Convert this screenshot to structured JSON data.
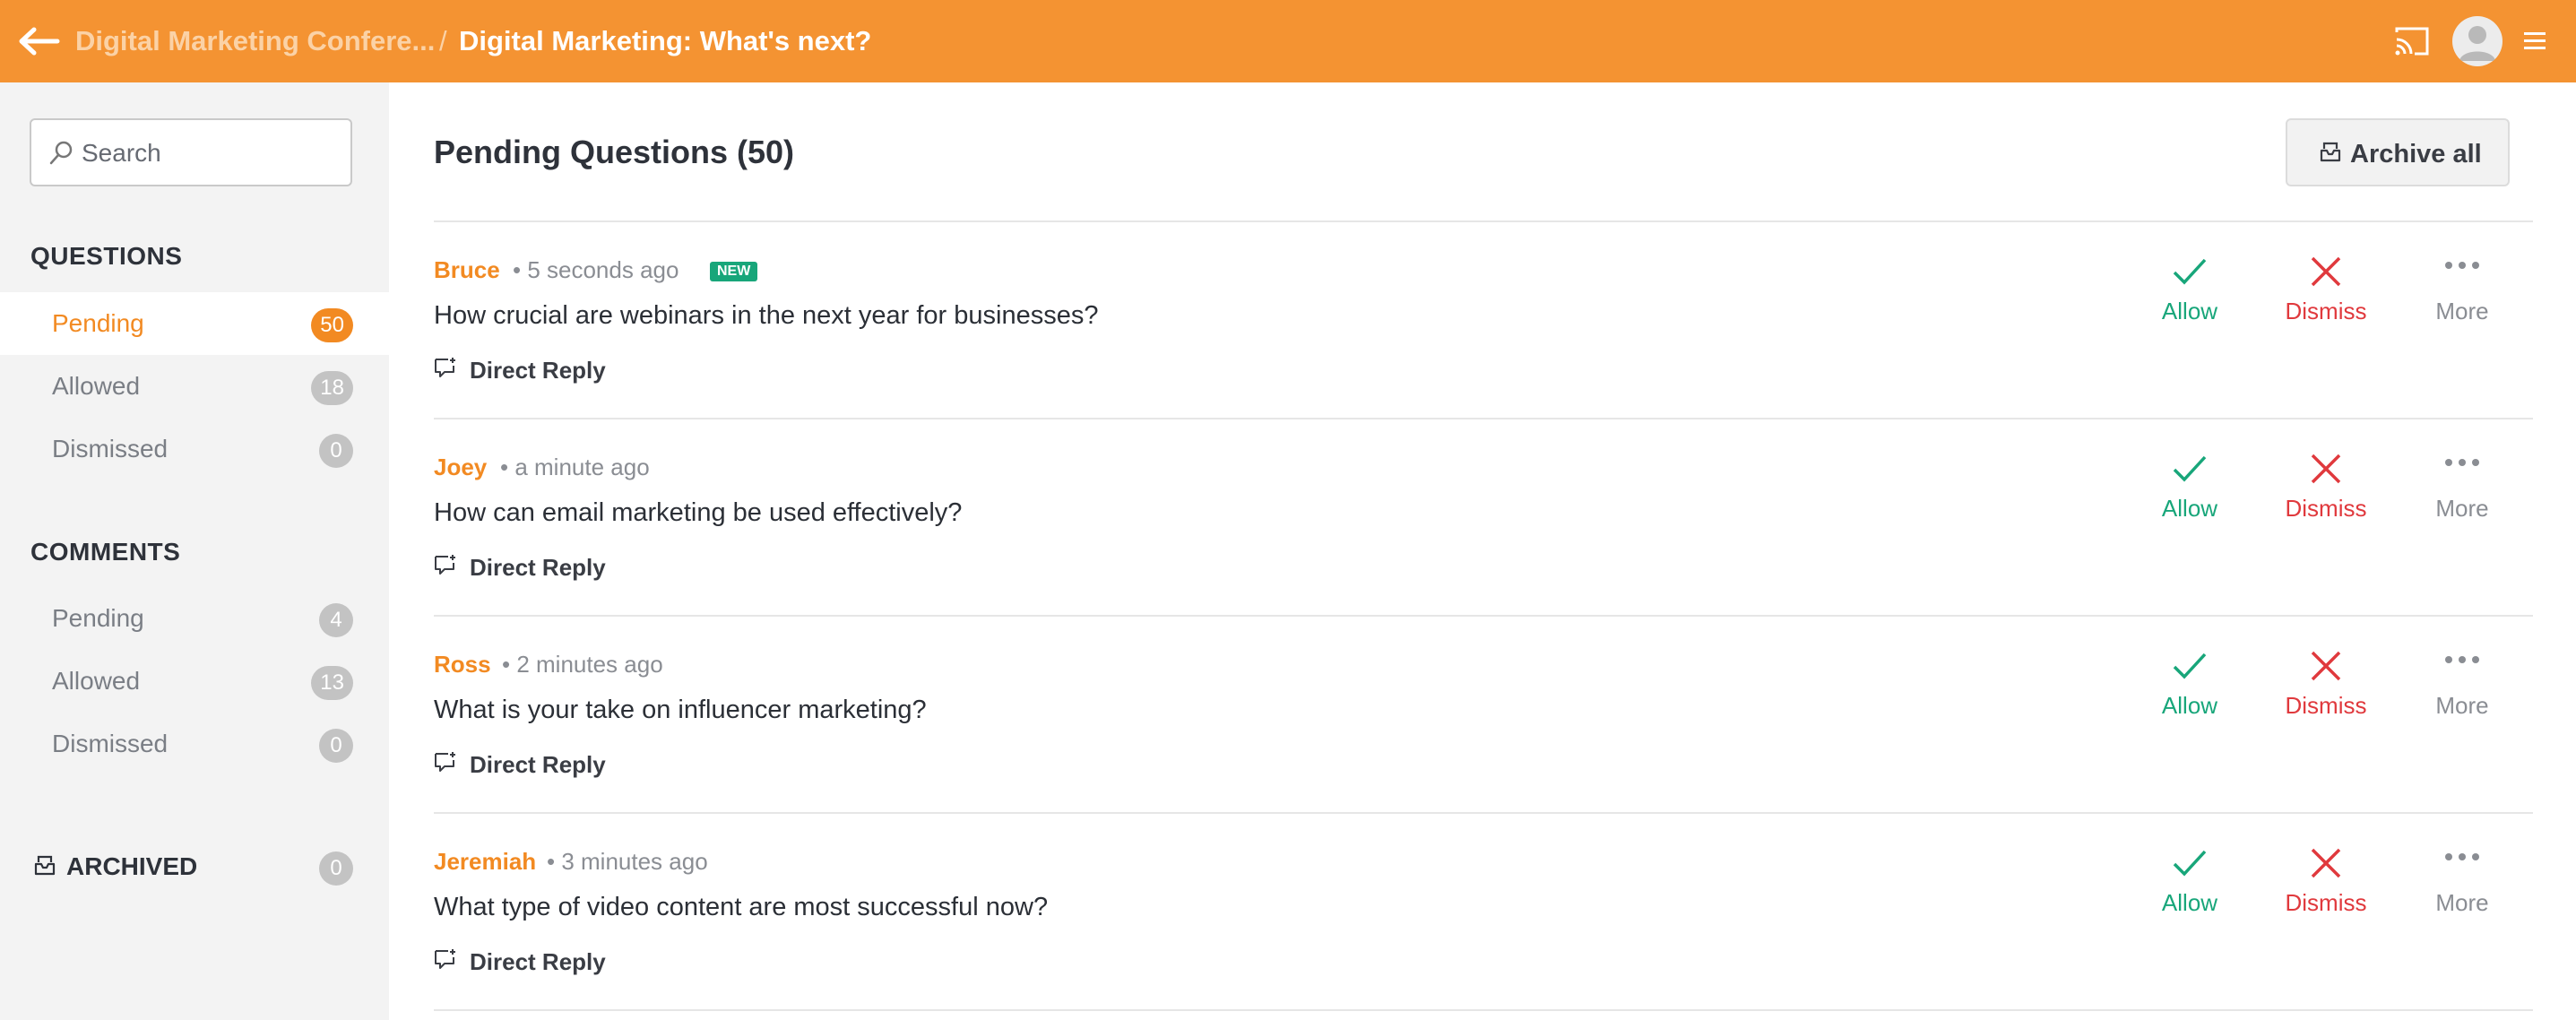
{
  "header": {
    "parent_title": "Digital Marketing Confere...",
    "separator": "/",
    "current_title": "Digital Marketing: What's next?"
  },
  "sidebar": {
    "search_placeholder": "Search",
    "questions_title": "QUESTIONS",
    "questions": [
      {
        "label": "Pending",
        "count": "50",
        "active": true
      },
      {
        "label": "Allowed",
        "count": "18"
      },
      {
        "label": "Dismissed",
        "count": "0"
      }
    ],
    "comments_title": "COMMENTS",
    "comments": [
      {
        "label": "Pending",
        "count": "4"
      },
      {
        "label": "Allowed",
        "count": "13"
      },
      {
        "label": "Dismissed",
        "count": "0"
      }
    ],
    "archived": {
      "label": "ARCHIVED",
      "count": "0"
    }
  },
  "main": {
    "title": "Pending Questions (50)",
    "archive_all_label": "Archive all",
    "questions": [
      {
        "author": "Bruce",
        "time": "5 seconds ago",
        "is_new": true,
        "new_label": "NEW",
        "text": "How crucial are webinars in the next year for businesses?"
      },
      {
        "author": "Joey",
        "time": "a minute ago",
        "text": "How can email marketing be used effectively?"
      },
      {
        "author": "Ross",
        "time": "2 minutes ago",
        "text": "What is your take on influencer marketing?"
      },
      {
        "author": "Jeremiah",
        "time": "3 minutes ago",
        "text": "What type of video content are most successful now?"
      }
    ],
    "reply_label": "Direct Reply",
    "actions": {
      "allow": "Allow",
      "dismiss": "Dismiss",
      "more": "More"
    }
  },
  "colors": {
    "brand_orange": "#f49332",
    "accent_orange": "#f28a22",
    "allow_green": "#18a67a",
    "dismiss_red": "#e0393d"
  },
  "icons": [
    "back-arrow-icon",
    "cast-icon",
    "avatar-icon",
    "hamburger-menu-icon",
    "search-icon",
    "archive-icon",
    "reply-icon",
    "check-icon",
    "close-icon",
    "more-dots-icon"
  ]
}
